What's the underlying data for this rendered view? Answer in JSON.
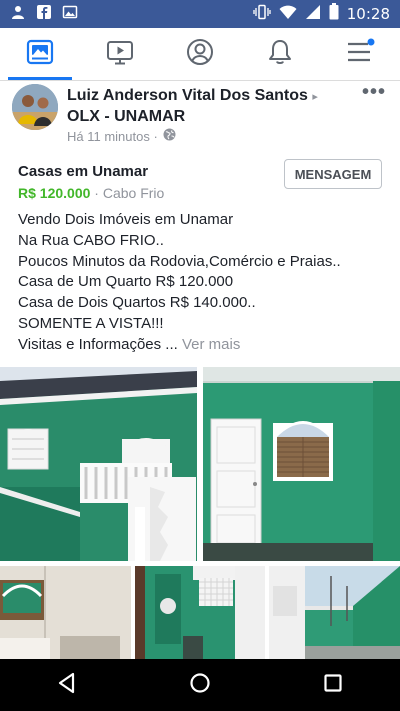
{
  "status_bar": {
    "time": "10:28",
    "notification_icons": [
      "person-status-icon",
      "facebook-notification-icon",
      "image-notification-icon"
    ],
    "system_icons": [
      "vibrate-icon",
      "wifi-icon",
      "signal-icon",
      "battery-icon"
    ]
  },
  "nav": {
    "items": [
      {
        "name": "feed-icon",
        "active": true
      },
      {
        "name": "watch-icon",
        "active": false
      },
      {
        "name": "profile-icon",
        "active": false
      },
      {
        "name": "notifications-bell-icon",
        "active": false
      },
      {
        "name": "menu-icon",
        "active": false,
        "badge": true
      }
    ],
    "accent": "#1877f2"
  },
  "post": {
    "author": "Luiz Anderson Vital Dos Santos",
    "group_arrow": "▸",
    "group": "OLX - UNAMAR",
    "time": "Há 11 minutos ·",
    "more": "•••",
    "listing": {
      "title": "Casas em Unamar",
      "price": "R$ 120.000",
      "location": " · Cabo Frio",
      "message_button": "MENSAGEM"
    },
    "description": [
      "Vendo Dois Imóveis em Unamar",
      "Na Rua CABO FRIO..",
      "Poucos Minutos da Rodovia,Comércio e Praias..",
      "Casa de Um Quarto R$ 120.000",
      "Casa de Dois Quartos R$ 140.000..",
      "SOMENTE A VISTA!!!"
    ],
    "last_line": "Visitas e Informações ...",
    "see_more": "Ver mais",
    "price_color": "#42b72a"
  },
  "system_nav": [
    "back-icon",
    "home-icon",
    "recents-icon"
  ]
}
